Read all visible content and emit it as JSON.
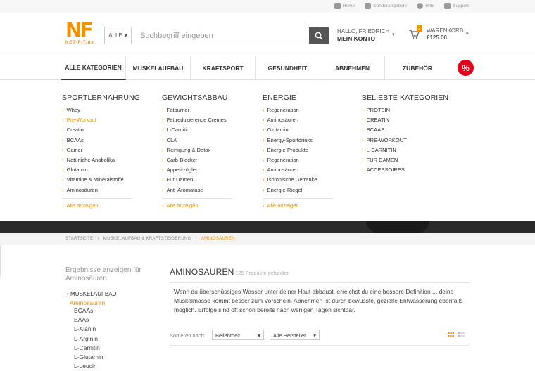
{
  "topbar": {
    "links": [
      {
        "label": "Home",
        "icon": "home-icon"
      },
      {
        "label": "Sonderangebote",
        "icon": "percent-icon"
      },
      {
        "label": "Hilfe",
        "icon": "help-icon"
      },
      {
        "label": "Support",
        "icon": "mail-icon"
      }
    ]
  },
  "header": {
    "logo_text": "NF",
    "logo_sub": "NET-FIT.de",
    "search_category": "ALLE",
    "search_placeholder": "Suchbegriff eingeben",
    "account_greeting": "HALLO, FRIEDRICH",
    "account_label": "MEIN KONTO",
    "cart_count": "2",
    "cart_label": "WARENKORB",
    "cart_total": "€125.00"
  },
  "nav": {
    "items": [
      {
        "label": "ALLE KATEGORIEN"
      },
      {
        "label": "MUSKELAUFBAU"
      },
      {
        "label": "KRAFTSPORT"
      },
      {
        "label": "GESUNDHEIT"
      },
      {
        "label": "ABNEHMEN"
      },
      {
        "label": "ZUBEHÖR"
      }
    ],
    "sale_label": "%"
  },
  "mega": {
    "columns": [
      {
        "title": "SPORTLERNAHRUNG",
        "items": [
          "Whey",
          "Pre-Workout",
          "Creatin",
          "BCAAs",
          "Gainer",
          "Natürliche Anabolika",
          "Glutamin",
          "Vitamine & Mineralstoffe",
          "Aminosäuren"
        ],
        "all_label": "Alle anzeigen"
      },
      {
        "title": "GEWICHTSABBAU",
        "items": [
          "Fatburner",
          "Fettreduzierende Cremes",
          "L-Carnitin",
          "CLA",
          "Reinigung & Detox",
          "Carb-Blocker",
          "Appetitzügler",
          "Für Damen",
          "Anti-Aromatase"
        ],
        "all_label": "Alle anzeigen"
      },
      {
        "title": "ENERGIE",
        "items": [
          "Regeneration",
          "Aminosäuren",
          "Glutamin",
          "Energy-Sportdrinks",
          "Energie-Produkte",
          "Regeneration",
          "Aminosäuren",
          "Isotonische Getränke",
          "Energie-Riegel"
        ],
        "all_label": "Alle anzeigen"
      },
      {
        "title": "BELIEBTE KATEGORIEN",
        "items": [
          "PROTEIN",
          "CREATIN",
          "BCAAS",
          "PRE-WORKOUT",
          "L-CARNITIN",
          "FÜR DAMEN",
          "ACCESSOIRES"
        ]
      }
    ]
  },
  "breadcrumb": [
    "STARTSEITE",
    "MUSKELAUFBAU & KRAFTSTEIGERUNG",
    "AMINOSÄUREN"
  ],
  "sidebar": {
    "title": "Ergebnisse anzeigen für Aminosäuren",
    "group": "MUSKELAUFBAU",
    "current": "Aminosäuren",
    "subs": [
      "BCAAs",
      "EAAs",
      "L-Alanin",
      "L-Arginin",
      "L-Carnitin",
      "L-Glutamin",
      "L-Leucin"
    ]
  },
  "main": {
    "title": "AMINOSÄUREN",
    "count": "125 Produkte gefunden",
    "description": "Wenn du überschüssiges Wasser unter deiner Haut abbaust, erreichst du eine bessere Definition ... deine Muskelmasse kommt besser zum Vorschein. Abnehmen ist durch bewusste, gezielte Entwässerung ebenfalls möglich. Erfolge sind oft schon bereits nach wenigen Tagen sichtbar.",
    "sort_label": "Sortieren nach:",
    "sort_value": "Beliebtheit",
    "maker_value": "Alle Hersteller"
  },
  "colors": {
    "accent": "#f39200",
    "sale": "#e2001a",
    "dark": "#2a2a2a"
  }
}
